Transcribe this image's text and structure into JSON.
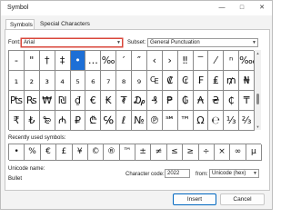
{
  "window": {
    "title": "Symbol",
    "minimize_glyph": "—",
    "maximize_glyph": "□",
    "close_glyph": "✕"
  },
  "tabs": [
    {
      "label": "Symbols",
      "active": true
    },
    {
      "label": "Special Characters",
      "active": false
    }
  ],
  "font": {
    "label": "Font:",
    "value": "Arial"
  },
  "subset": {
    "label": "Subset:",
    "value": "General Punctuation"
  },
  "symbols": [
    [
      "-",
      "\"",
      "†",
      "‡",
      "•",
      "…",
      "‰",
      "′",
      "″",
      "‹",
      "›",
      "‼",
      "‾",
      "⁄",
      "ⁿ",
      "‱"
    ],
    [
      "₁",
      "₂",
      "₃",
      "₄",
      "₅",
      "₆",
      "₇",
      "₈",
      "₉",
      "₠",
      "₡",
      "₢",
      "₣",
      "₤",
      "₥",
      "₦"
    ],
    [
      "₧",
      "₨",
      "₩",
      "₪",
      "₫",
      "€",
      "₭",
      "₮",
      "₯",
      "₰",
      "₱",
      "₲",
      "₳",
      "₴",
      "₵",
      "₸"
    ],
    [
      "₹",
      "₺",
      "₻",
      "₼",
      "₽",
      "₾",
      "℅",
      "ℓ",
      "№",
      "℗",
      "℠",
      "™",
      "Ω",
      "℮",
      "⅓",
      "⅔"
    ]
  ],
  "selected_symbol": "•",
  "recent": {
    "label": "Recently used symbols:",
    "symbols": [
      "•",
      "%",
      "€",
      "£",
      "¥",
      "©",
      "®",
      "™",
      "±",
      "≠",
      "≤",
      "≥",
      "÷",
      "×",
      "∞",
      "µ"
    ]
  },
  "unicode_name": {
    "label": "Unicode name:",
    "value": "Bullet"
  },
  "character_code": {
    "label": "Character code:",
    "value": "2022"
  },
  "from": {
    "label": "from:",
    "value": "Unicode (hex)"
  },
  "buttons": {
    "insert": "Insert",
    "cancel": "Cancel"
  },
  "colors": {
    "selection": "#1d6fd6",
    "focus_border": "#d9473b"
  }
}
